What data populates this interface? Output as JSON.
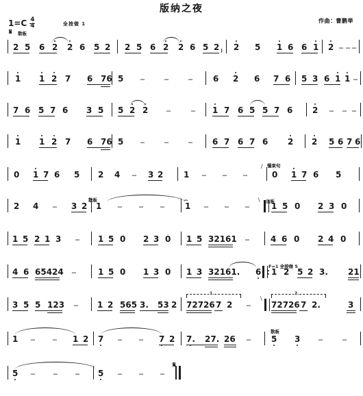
{
  "header": {
    "title": "版纳之夜",
    "key_signature": "1=C",
    "time_signature_num": "4",
    "time_signature_den": "4",
    "fingering_note": "全按做  1",
    "composer": "作曲：曹鹏举",
    "segno_symbol": "𝄋",
    "tempo_mark": "散板"
  },
  "annotations": {
    "breath1": "\\",
    "slow_down": "慢束句",
    "chu_ban": "出板",
    "san_ban_2": "散板",
    "key_change": "F=1  全按做 5",
    "bracket1": "1.",
    "bracket2": "2.",
    "san_ban_3": "散板",
    "segno_end": "𝄋"
  },
  "score": {
    "rows": [
      {
        "id": "row-1",
        "measures": [
          "2 5 6 2 2 6 5 2",
          "2 5 6 2 2 6 5 2",
          "2̇  5  1̇ 6 6 1̇",
          "2̇  -  -  -"
        ]
      },
      {
        "id": "row-2",
        "measures": [
          "1̇  1̇ 2̇ 7  6 76",
          "5  -  -  -",
          "6  2̇  6  7 6",
          "5 3 6 1̇  1̇  -"
        ]
      },
      {
        "id": "row-3",
        "measures": [
          "7 6 5 7 6  3 5",
          "5 2̇ 2̇  -  -",
          "1̇ 7 6 5 5 7 6",
          "2̇  -  -  -"
        ]
      },
      {
        "id": "row-4",
        "measures": [
          "1̇  1̇ 2̇ 7  6 76",
          "5  -  -  -",
          "6 7 6 7 6   2̇",
          "2̇  5 6 7 6 7"
        ]
      },
      {
        "id": "row-5",
        "measures": [
          "0  1̇ 7 6  5",
          "2  4  -  3 2",
          "1  -  -  -",
          "0  1̇ 7 6  5"
        ]
      },
      {
        "id": "row-6",
        "measures": [
          "2  4  -  3 2",
          "1  -  -  -",
          "1̂  -  -  -",
          "1 5 0  2 3 0"
        ]
      },
      {
        "id": "row-7",
        "measures": [
          "1 5 2 1 3  -",
          "1 5 0  2 3 0",
          "1 5 32161  -",
          "4 6 0  2 4 0"
        ]
      },
      {
        "id": "row-8",
        "measures": [
          "4 6 65424  -",
          "1 5 0  1 3 0",
          "1 3 32161.  6",
          "1 2 5 2 3.  21"
        ]
      },
      {
        "id": "row-9",
        "measures": [
          "3 5 5 123  -",
          "1 2 565 3.  53 2",
          "72726 7 2  -",
          "72726 7 2.  3"
        ]
      },
      {
        "id": "row-10",
        "measures": [
          "1  -  -  1 2",
          "7.  -  -  7 2",
          "7. 27. 26  -",
          "5  3  -  -"
        ]
      },
      {
        "id": "row-11",
        "measures": [
          "5  -  -  -",
          "5  -  -  -"
        ]
      }
    ]
  }
}
